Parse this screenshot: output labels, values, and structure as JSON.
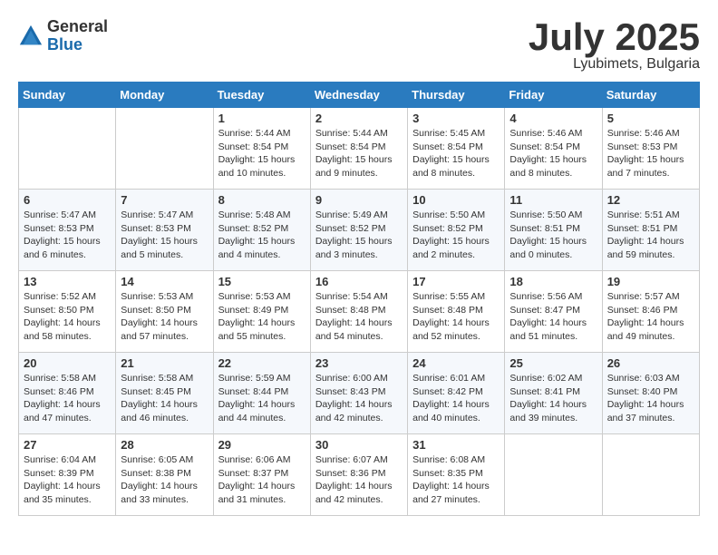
{
  "logo": {
    "general": "General",
    "blue": "Blue"
  },
  "title": "July 2025",
  "subtitle": "Lyubimets, Bulgaria",
  "days_of_week": [
    "Sunday",
    "Monday",
    "Tuesday",
    "Wednesday",
    "Thursday",
    "Friday",
    "Saturday"
  ],
  "weeks": [
    [
      {
        "day": "",
        "info": ""
      },
      {
        "day": "",
        "info": ""
      },
      {
        "day": "1",
        "info": "Sunrise: 5:44 AM\nSunset: 8:54 PM\nDaylight: 15 hours and 10 minutes."
      },
      {
        "day": "2",
        "info": "Sunrise: 5:44 AM\nSunset: 8:54 PM\nDaylight: 15 hours and 9 minutes."
      },
      {
        "day": "3",
        "info": "Sunrise: 5:45 AM\nSunset: 8:54 PM\nDaylight: 15 hours and 8 minutes."
      },
      {
        "day": "4",
        "info": "Sunrise: 5:46 AM\nSunset: 8:54 PM\nDaylight: 15 hours and 8 minutes."
      },
      {
        "day": "5",
        "info": "Sunrise: 5:46 AM\nSunset: 8:53 PM\nDaylight: 15 hours and 7 minutes."
      }
    ],
    [
      {
        "day": "6",
        "info": "Sunrise: 5:47 AM\nSunset: 8:53 PM\nDaylight: 15 hours and 6 minutes."
      },
      {
        "day": "7",
        "info": "Sunrise: 5:47 AM\nSunset: 8:53 PM\nDaylight: 15 hours and 5 minutes."
      },
      {
        "day": "8",
        "info": "Sunrise: 5:48 AM\nSunset: 8:52 PM\nDaylight: 15 hours and 4 minutes."
      },
      {
        "day": "9",
        "info": "Sunrise: 5:49 AM\nSunset: 8:52 PM\nDaylight: 15 hours and 3 minutes."
      },
      {
        "day": "10",
        "info": "Sunrise: 5:50 AM\nSunset: 8:52 PM\nDaylight: 15 hours and 2 minutes."
      },
      {
        "day": "11",
        "info": "Sunrise: 5:50 AM\nSunset: 8:51 PM\nDaylight: 15 hours and 0 minutes."
      },
      {
        "day": "12",
        "info": "Sunrise: 5:51 AM\nSunset: 8:51 PM\nDaylight: 14 hours and 59 minutes."
      }
    ],
    [
      {
        "day": "13",
        "info": "Sunrise: 5:52 AM\nSunset: 8:50 PM\nDaylight: 14 hours and 58 minutes."
      },
      {
        "day": "14",
        "info": "Sunrise: 5:53 AM\nSunset: 8:50 PM\nDaylight: 14 hours and 57 minutes."
      },
      {
        "day": "15",
        "info": "Sunrise: 5:53 AM\nSunset: 8:49 PM\nDaylight: 14 hours and 55 minutes."
      },
      {
        "day": "16",
        "info": "Sunrise: 5:54 AM\nSunset: 8:48 PM\nDaylight: 14 hours and 54 minutes."
      },
      {
        "day": "17",
        "info": "Sunrise: 5:55 AM\nSunset: 8:48 PM\nDaylight: 14 hours and 52 minutes."
      },
      {
        "day": "18",
        "info": "Sunrise: 5:56 AM\nSunset: 8:47 PM\nDaylight: 14 hours and 51 minutes."
      },
      {
        "day": "19",
        "info": "Sunrise: 5:57 AM\nSunset: 8:46 PM\nDaylight: 14 hours and 49 minutes."
      }
    ],
    [
      {
        "day": "20",
        "info": "Sunrise: 5:58 AM\nSunset: 8:46 PM\nDaylight: 14 hours and 47 minutes."
      },
      {
        "day": "21",
        "info": "Sunrise: 5:58 AM\nSunset: 8:45 PM\nDaylight: 14 hours and 46 minutes."
      },
      {
        "day": "22",
        "info": "Sunrise: 5:59 AM\nSunset: 8:44 PM\nDaylight: 14 hours and 44 minutes."
      },
      {
        "day": "23",
        "info": "Sunrise: 6:00 AM\nSunset: 8:43 PM\nDaylight: 14 hours and 42 minutes."
      },
      {
        "day": "24",
        "info": "Sunrise: 6:01 AM\nSunset: 8:42 PM\nDaylight: 14 hours and 40 minutes."
      },
      {
        "day": "25",
        "info": "Sunrise: 6:02 AM\nSunset: 8:41 PM\nDaylight: 14 hours and 39 minutes."
      },
      {
        "day": "26",
        "info": "Sunrise: 6:03 AM\nSunset: 8:40 PM\nDaylight: 14 hours and 37 minutes."
      }
    ],
    [
      {
        "day": "27",
        "info": "Sunrise: 6:04 AM\nSunset: 8:39 PM\nDaylight: 14 hours and 35 minutes."
      },
      {
        "day": "28",
        "info": "Sunrise: 6:05 AM\nSunset: 8:38 PM\nDaylight: 14 hours and 33 minutes."
      },
      {
        "day": "29",
        "info": "Sunrise: 6:06 AM\nSunset: 8:37 PM\nDaylight: 14 hours and 31 minutes."
      },
      {
        "day": "30",
        "info": "Sunrise: 6:07 AM\nSunset: 8:36 PM\nDaylight: 14 hours and 42 minutes."
      },
      {
        "day": "31",
        "info": "Sunrise: 6:08 AM\nSunset: 8:35 PM\nDaylight: 14 hours and 27 minutes."
      },
      {
        "day": "",
        "info": ""
      },
      {
        "day": "",
        "info": ""
      }
    ]
  ]
}
